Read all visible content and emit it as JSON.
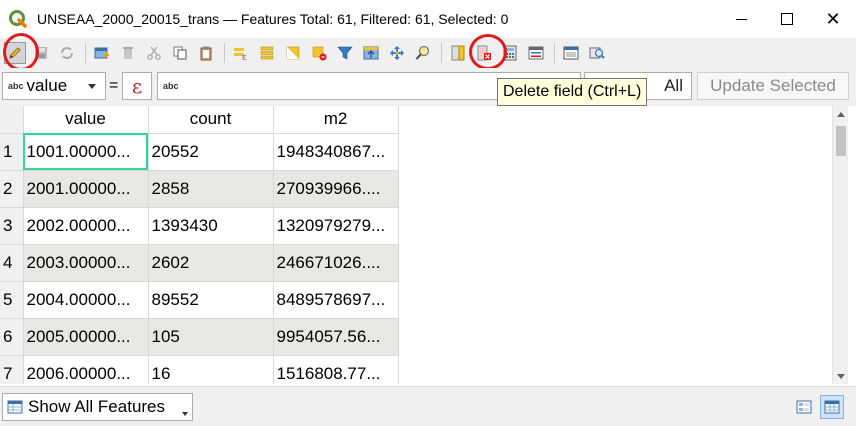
{
  "window": {
    "title": "UNSEAA_2000_20015_trans — Features Total: 61, Filtered: 61, Selected: 0",
    "controls": {
      "close": "✕"
    }
  },
  "toolbar": {
    "buttons": [
      "toggle-editing",
      "save-edits",
      "reload-table",
      "add-feature",
      "delete-feature",
      "cut",
      "copy",
      "paste",
      "expression-select",
      "select-all",
      "invert-selection",
      "deselect-all",
      "filter-select",
      "move-selection-top",
      "pan-to-selection",
      "zoom-to-selection",
      "new-field",
      "delete-field",
      "field-calculator",
      "conditional-formatting",
      "dock-table",
      "actions"
    ]
  },
  "expression_bar": {
    "field_type_tag": "abc",
    "field_selected": "value",
    "equals": "=",
    "epsilon": "ε",
    "input_type_tag": "abc",
    "input_value": "",
    "update_all_label": "All",
    "update_selected_label": "Update Selected"
  },
  "tooltip": {
    "text": "Delete field (Ctrl+L)"
  },
  "table": {
    "columns": [
      "value",
      "count",
      "m2"
    ],
    "rows": [
      {
        "n": "1",
        "value": "1001.00000...",
        "count": "20552",
        "m2": "1948340867..."
      },
      {
        "n": "2",
        "value": "2001.00000...",
        "count": "2858",
        "m2": "270939966...."
      },
      {
        "n": "3",
        "value": "2002.00000...",
        "count": "1393430",
        "m2": "1320979279..."
      },
      {
        "n": "4",
        "value": "2003.00000...",
        "count": "2602",
        "m2": "246671026...."
      },
      {
        "n": "5",
        "value": "2004.00000...",
        "count": "89552",
        "m2": "8489578697..."
      },
      {
        "n": "6",
        "value": "2005.00000...",
        "count": "105",
        "m2": "9954057.56..."
      },
      {
        "n": "7",
        "value": "2006.00000...",
        "count": "16",
        "m2": "1516808.77..."
      }
    ]
  },
  "bottom_bar": {
    "show_features_label": "Show All Features"
  },
  "colors": {
    "accent_ring": "#e0191a",
    "focus_cell": "#36d39a",
    "alt_row": "#e9e7e3",
    "tooltip_bg": "#ffffdc"
  }
}
